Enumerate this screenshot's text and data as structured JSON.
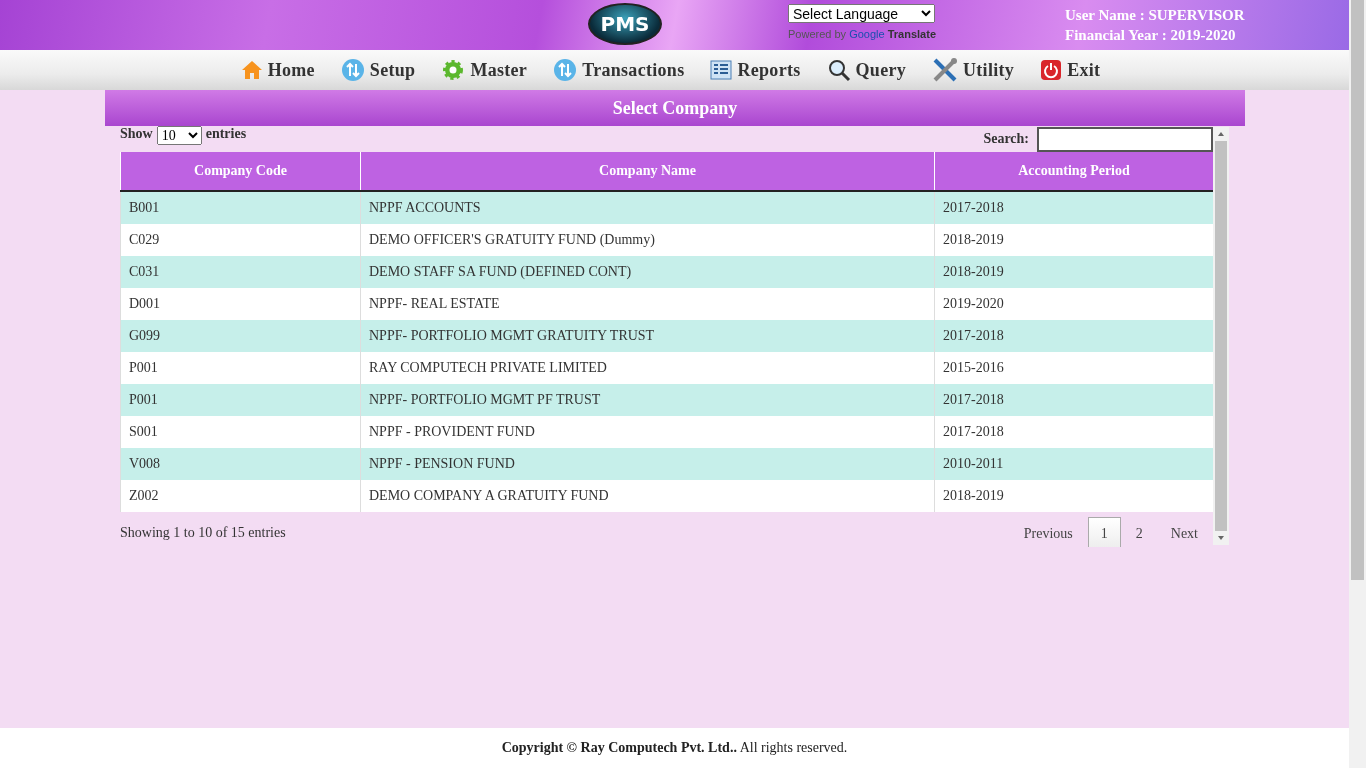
{
  "header": {
    "logo": "PMS",
    "language_select": "Select Language",
    "powered_by": "Powered by",
    "google": "Google",
    "translate": "Translate",
    "user_name": "User Name : SUPERVISOR",
    "financial_year": "Financial Year : 2019-2020"
  },
  "nav": [
    {
      "label": "Home",
      "kind": "home"
    },
    {
      "label": "Setup",
      "kind": "setup"
    },
    {
      "label": "Master",
      "kind": "master"
    },
    {
      "label": "Transactions",
      "kind": "transactions"
    },
    {
      "label": "Reports",
      "kind": "reports"
    },
    {
      "label": "Query",
      "kind": "query"
    },
    {
      "label": "Utility",
      "kind": "utility"
    },
    {
      "label": "Exit",
      "kind": "exit"
    }
  ],
  "panel": {
    "title": "Select Company",
    "show": "Show",
    "entries_value": "10",
    "entries": "entries",
    "search_label": "Search:"
  },
  "table": {
    "columns": [
      "Company Code",
      "Company Name",
      "Accounting Period"
    ],
    "rows": [
      [
        "B001",
        "NPPF ACCOUNTS",
        "2017-2018"
      ],
      [
        "C029",
        "DEMO OFFICER'S GRATUITY FUND (Dummy)",
        "2018-2019"
      ],
      [
        "C031",
        "DEMO STAFF SA FUND (DEFINED CONT)",
        "2018-2019"
      ],
      [
        "D001",
        "NPPF- REAL ESTATE",
        "2019-2020"
      ],
      [
        "G099",
        "NPPF- PORTFOLIO MGMT GRATUITY TRUST",
        "2017-2018"
      ],
      [
        "P001",
        "RAY COMPUTECH PRIVATE LIMITED",
        "2015-2016"
      ],
      [
        "P001",
        "NPPF- PORTFOLIO MGMT PF TRUST",
        "2017-2018"
      ],
      [
        "S001",
        "NPPF - PROVIDENT FUND",
        "2017-2018"
      ],
      [
        "V008",
        "NPPF - PENSION FUND",
        "2010-2011"
      ],
      [
        "Z002",
        "DEMO COMPANY A GRATUITY FUND",
        "2018-2019"
      ]
    ]
  },
  "info": "Showing 1 to 10 of 15 entries",
  "pagination": {
    "previous": "Previous",
    "pages": [
      {
        "label": "1",
        "selected": true
      },
      {
        "label": "2",
        "selected": false
      }
    ],
    "next": "Next"
  },
  "footer": "**Copyright © Ray Computech Pvt. Ltd..** All rights reserved."
}
